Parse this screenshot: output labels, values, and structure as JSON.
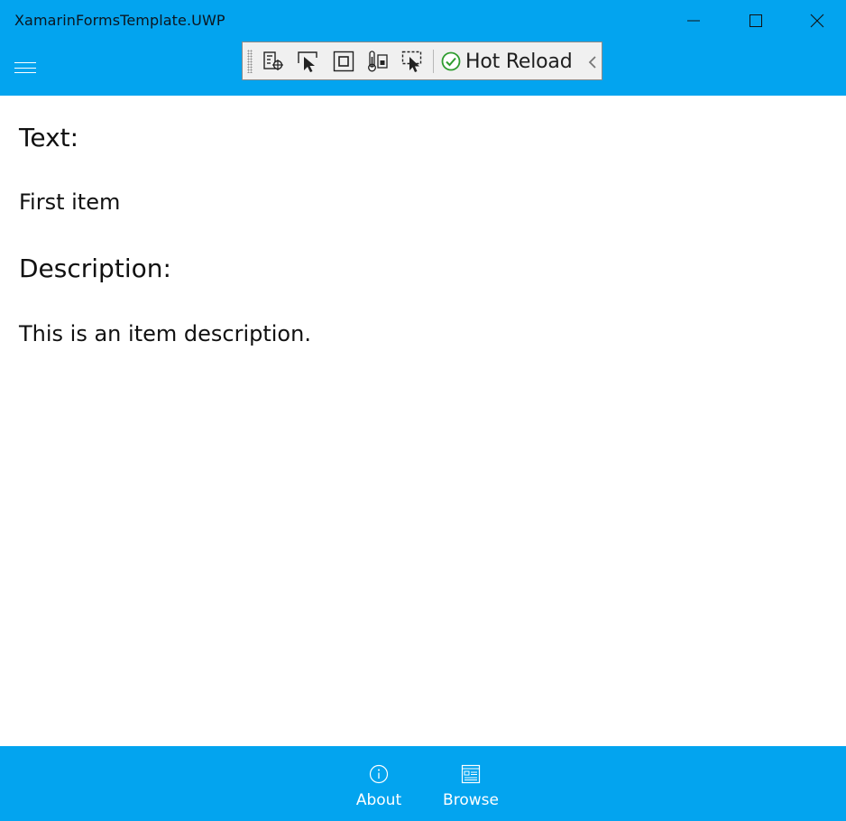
{
  "window": {
    "title": "XamarinFormsTemplate.UWP",
    "accent_color": "#03a4ef"
  },
  "hot_reload_toolbar": {
    "tools": [
      "go-to-live-visual-tree-icon",
      "select-element-icon",
      "display-layout-adorners-icon",
      "track-focus-icon",
      "binding-failures-icon",
      "preview-selection-icon"
    ],
    "hot_reload_label": "Hot Reload",
    "status_color": "#2e9c2e"
  },
  "item_detail": {
    "text_label": "Text:",
    "text_value": "First item",
    "description_label": "Description:",
    "description_value": "This is an item description."
  },
  "tabs": [
    {
      "label": "About",
      "icon": "info-icon"
    },
    {
      "label": "Browse",
      "icon": "list-icon"
    }
  ]
}
